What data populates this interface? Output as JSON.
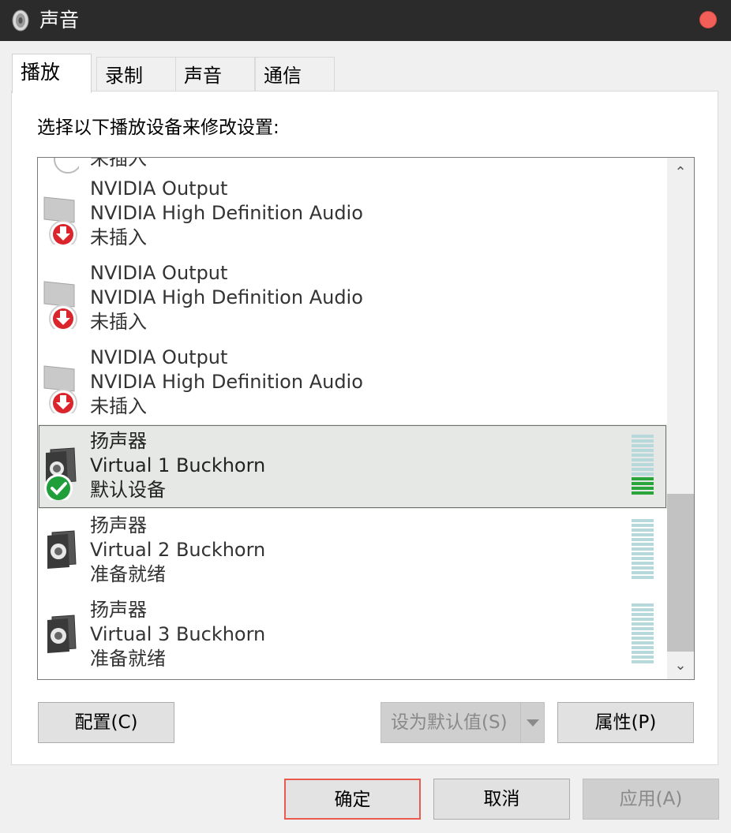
{
  "window": {
    "title": "声音",
    "title_icon": "speaker-icon",
    "close_icon": "close-dot-icon"
  },
  "tabs": [
    {
      "label": "播放",
      "active": true
    },
    {
      "label": "录制",
      "active": false
    },
    {
      "label": "声音",
      "active": false
    },
    {
      "label": "通信",
      "active": false
    }
  ],
  "instruction": "选择以下播放设备来修改设置:",
  "devices": [
    {
      "name": "",
      "description": "",
      "status": "未插入",
      "icon": "unplugged-device-icon",
      "partial": true
    },
    {
      "name": "NVIDIA Output",
      "description": "NVIDIA High Definition Audio",
      "status": "未插入",
      "icon": "monitor-unplugged-icon"
    },
    {
      "name": "NVIDIA Output",
      "description": "NVIDIA High Definition Audio",
      "status": "未插入",
      "icon": "monitor-unplugged-icon"
    },
    {
      "name": "NVIDIA Output",
      "description": "NVIDIA High Definition Audio",
      "status": "未插入",
      "icon": "monitor-unplugged-icon"
    },
    {
      "name": "扬声器",
      "description": "Virtual 1 Buckhorn",
      "status": "默认设备",
      "icon": "speaker-default-icon",
      "selected": true,
      "level": 0.3
    },
    {
      "name": "扬声器",
      "description": "Virtual 2 Buckhorn",
      "status": "准备就绪",
      "icon": "speaker-icon",
      "level": 0
    },
    {
      "name": "扬声器",
      "description": "Virtual 3 Buckhorn",
      "status": "准备就绪",
      "icon": "speaker-icon",
      "level": 0
    }
  ],
  "buttons": {
    "configure": "配置(C)",
    "set_default": "设为默认值(S)",
    "properties": "属性(P)",
    "ok": "确定",
    "cancel": "取消",
    "apply": "应用(A)"
  },
  "colors": {
    "titlebar": "#2b2b2b",
    "close": "#f25f58",
    "unplug_red": "#d9252b",
    "default_green": "#1f9e3a",
    "level_green": "#2aa53b",
    "level_idle": "#b7d9dc",
    "ok_border": "#e95b4f"
  }
}
